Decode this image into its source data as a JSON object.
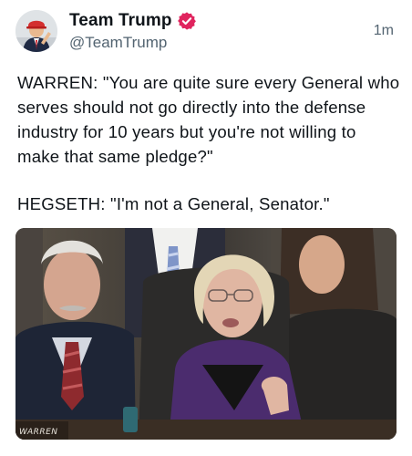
{
  "post": {
    "author": {
      "display_name": "Team Trump",
      "handle": "@TeamTrump",
      "verified": true,
      "verified_color": "#e0245e",
      "avatar_icon": "avatar-person-icon"
    },
    "timestamp": "1m",
    "text": {
      "paragraph1": "WARREN: \"You are quite sure every General who serves should not go directly into the defense industry for 10 years but you're not willing to make that same pledge?\"",
      "paragraph2": "HEGSETH: \"I'm not a General, Senator.\""
    },
    "media": {
      "nameplate": "WARREN"
    }
  },
  "colors": {
    "text": "#0f1419",
    "secondary_text": "#536471",
    "background": "#ffffff"
  }
}
